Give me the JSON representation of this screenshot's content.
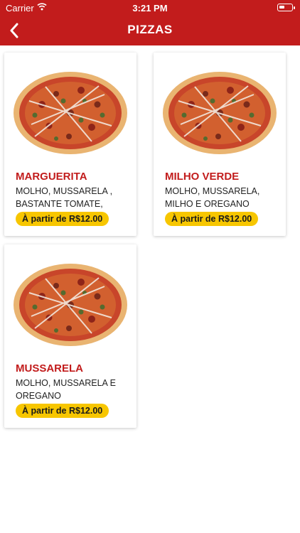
{
  "status_bar": {
    "carrier": "Carrier",
    "time": "3:21 PM"
  },
  "header": {
    "title": "PIZZAS"
  },
  "products": [
    {
      "name": "MARGUERITA",
      "description": "MOLHO, MUSSARELA , BASTANTE TOMATE, ORÉGANO E...",
      "price": "À partir de R$12.00"
    },
    {
      "name": "MILHO VERDE",
      "description": "MOLHO, MUSSARELA, MILHO E OREGANO",
      "price": "À partir de R$12.00"
    },
    {
      "name": "MUSSARELA",
      "description": "MOLHO, MUSSARELA E OREGANO",
      "price": "À partir de R$12.00"
    }
  ],
  "colors": {
    "brand": "#c21c1c",
    "price_badge": "#f7c600"
  }
}
